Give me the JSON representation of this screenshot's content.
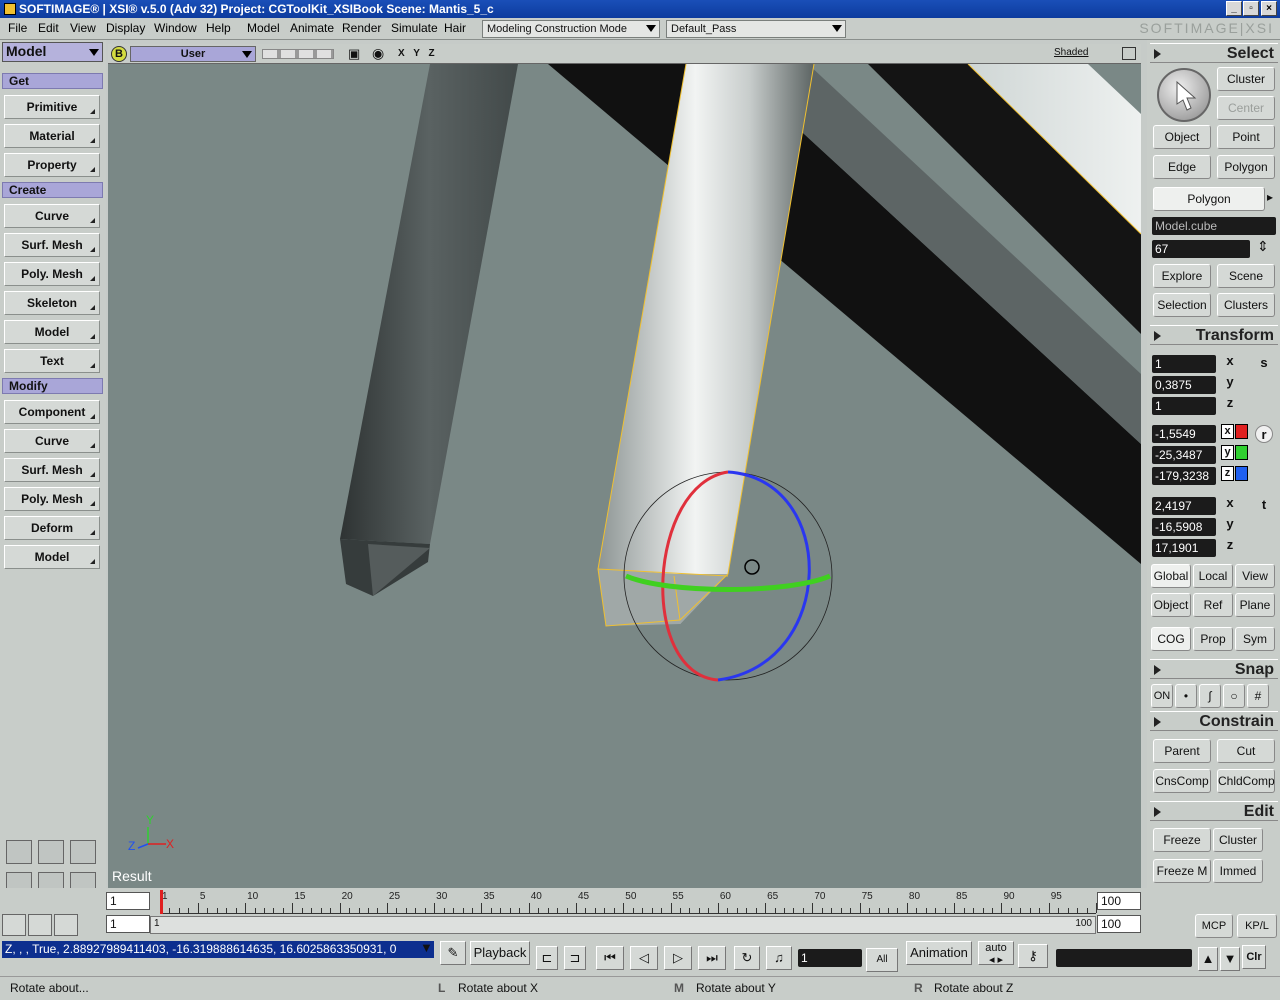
{
  "titlebar": {
    "title": "SOFTIMAGE® | XSI® v.5.0 (Adv 32) Project: CGToolKit_XSIBook    Scene: Mantis_5_c"
  },
  "menubar": {
    "items": [
      {
        "label": "File"
      },
      {
        "label": "Edit"
      },
      {
        "label": "View"
      },
      {
        "label": "Display"
      },
      {
        "label": "Window"
      },
      {
        "label": "Help"
      },
      {
        "label": "Model"
      },
      {
        "label": "Animate"
      },
      {
        "label": "Render"
      },
      {
        "label": "Simulate"
      },
      {
        "label": "Hair"
      }
    ],
    "mode": "Modeling Construction Mode",
    "pass": "Default_Pass",
    "brand": "SOFTIMAGE|XSI"
  },
  "left_panel": {
    "module": "Model",
    "sections": [
      {
        "header": "Get",
        "buttons": [
          "Primitive",
          "Material",
          "Property"
        ]
      },
      {
        "header": "Create",
        "buttons": [
          "Curve",
          "Surf. Mesh",
          "Poly. Mesh",
          "Skeleton",
          "Model",
          "Text"
        ]
      },
      {
        "header": "Modify",
        "buttons": [
          "Component",
          "Curve",
          "Surf. Mesh",
          "Poly. Mesh",
          "Deform",
          "Model"
        ]
      }
    ]
  },
  "viewport": {
    "camera": "User",
    "axes": "X Y Z",
    "display_mode": "Shaded",
    "label": "Result",
    "axis_labels": {
      "y": "Y",
      "x": "X",
      "z": "Z"
    }
  },
  "right_panel": {
    "select": {
      "header": "Select",
      "cluster": "Cluster",
      "center": "Center",
      "object": "Object",
      "point": "Point",
      "edge": "Edge",
      "polygon": "Polygon",
      "mode_button": "Polygon",
      "selection_name": "Model.cube",
      "selection_count": "67",
      "explore": "Explore",
      "scene": "Scene",
      "selection": "Selection",
      "clusters": "Clusters"
    },
    "transform": {
      "header": "Transform",
      "scale": [
        "1",
        "0,3875",
        "1"
      ],
      "rotation": [
        "-1,5549",
        "-25,3487",
        "-179,3238"
      ],
      "translation": [
        "2,4197",
        "-16,5908",
        "17,1901"
      ],
      "axis_letters": [
        "x",
        "y",
        "z"
      ],
      "side_letters": {
        "scale": "s",
        "rotate": "r",
        "translate": "t"
      },
      "rot_colors": [
        "#e02020",
        "#30d030",
        "#2060f0"
      ],
      "ref_buttons": [
        "Global",
        "Local",
        "View",
        "Object",
        "Ref",
        "Plane"
      ],
      "cog_buttons": [
        "COG",
        "Prop",
        "Sym"
      ]
    },
    "snap": {
      "header": "Snap",
      "on": "ON"
    },
    "constrain": {
      "header": "Constrain",
      "buttons": [
        "Parent",
        "Cut",
        "CnsComp",
        "ChldComp"
      ]
    },
    "edit": {
      "header": "Edit",
      "buttons": [
        "Freeze",
        "Cluster",
        "Freeze M",
        "Immed"
      ]
    },
    "mcp": "MCP",
    "kpl": "KP/L"
  },
  "timeline": {
    "start_field": "1",
    "end_field": "100",
    "start_field2": "1",
    "end_field2": "100",
    "range_start_label": "1",
    "range_end_label": "100",
    "ticks": [
      "1",
      "5",
      "10",
      "15",
      "20",
      "25",
      "30",
      "35",
      "40",
      "45",
      "50",
      "55",
      "60",
      "65",
      "70",
      "75",
      "80",
      "85",
      "90",
      "95"
    ],
    "current_frame": 1
  },
  "command_bar": {
    "command_line": "Z, , , True, 2.88927989411403, -16.319888614635, 16.6025863350931, 0",
    "playback": "Playback",
    "frame": "1",
    "all": "All",
    "animation": "Animation",
    "auto": "auto",
    "clr": "Clr"
  },
  "status_bar": {
    "message": "Rotate about...",
    "left_key": "L",
    "left_action": "Rotate about X",
    "middle_key": "M",
    "middle_action": "Rotate about Y",
    "right_key": "R",
    "right_action": "Rotate about Z"
  }
}
